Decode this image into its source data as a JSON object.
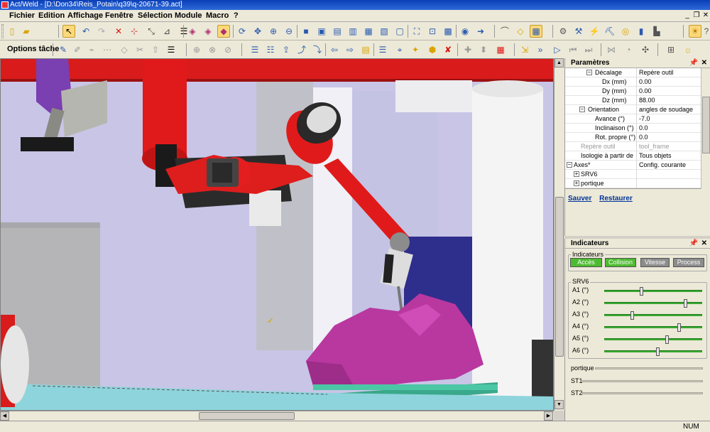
{
  "app": {
    "title": "Act/Weld - [D:\\Don34\\Reis_Potain\\q39\\q-20671-39.act]"
  },
  "menu": {
    "items": [
      "Fichier",
      "Edition",
      "Affichage",
      "Fenêtre",
      "Sélection",
      "Module",
      "Macro",
      "?"
    ]
  },
  "toolbar2": {
    "options_label": "Options tâche"
  },
  "parametres": {
    "title": "Paramètres",
    "rows": [
      {
        "key": "Décalage",
        "value": "Repère outil",
        "expander": "minus"
      },
      {
        "key": "Dx (mm)",
        "value": "0.00"
      },
      {
        "key": "Dy (mm)",
        "value": "0.00"
      },
      {
        "key": "Dz (mm)",
        "value": "88.00"
      },
      {
        "key": "Orientation",
        "value": "angles de soudage",
        "expander": "minus"
      },
      {
        "key": "Avance (°)",
        "value": "-7.0"
      },
      {
        "key": "Inclinaison (°)",
        "value": "0.0"
      },
      {
        "key": "Rot. propre (°)",
        "value": "0.0"
      },
      {
        "key": "Repère outil",
        "value": "tool_frame"
      },
      {
        "key": "Isologie à partir de",
        "value": "Tous objets"
      },
      {
        "key": "Axes*",
        "value": "Config. courante",
        "expander": "minus"
      },
      {
        "key": "SRV6",
        "value": "",
        "expander": "plus"
      },
      {
        "key": "portique",
        "value": "",
        "expander": "plus"
      }
    ],
    "save_label": "Sauver",
    "restore_label": "Restaurer"
  },
  "indicateurs": {
    "title": "Indicateurs",
    "group_label": "Indicateurs",
    "buttons": [
      {
        "label": "Accès",
        "state": "on"
      },
      {
        "label": "Collision",
        "state": "on"
      },
      {
        "label": "Vitesse",
        "state": "off"
      },
      {
        "label": "Process",
        "state": "off"
      }
    ],
    "srv6_label": "SRV6",
    "axes": [
      {
        "label": "A1 (°)",
        "level": 0.38
      },
      {
        "label": "A2 (°)",
        "level": 0.85
      },
      {
        "label": "A3 (°)",
        "level": 0.28
      },
      {
        "label": "A4 (°)",
        "level": 0.78
      },
      {
        "label": "A5 (°)",
        "level": 0.65
      },
      {
        "label": "A6 (°)",
        "level": 0.55
      }
    ],
    "groups": [
      "portique",
      "ST1",
      "ST2"
    ]
  },
  "status": {
    "num": "NUM"
  },
  "icons": {
    "tb1": [
      "new-file-icon",
      "open-folder-icon",
      "select-arrow-icon",
      "undo-icon",
      "redo-icon",
      "cut-point-icon",
      "frame-icon",
      "link-icon",
      "geometry-icon",
      "list-icon",
      "paint-icon",
      "paint-alt-icon",
      "paint-active-icon",
      "rotate-icon",
      "pan-icon",
      "zoom-in-icon",
      "zoom-out-icon",
      "cube-front-icon",
      "cube-top-icon",
      "cube-side-icon",
      "cube-iso-icon",
      "cube-back-icon",
      "cube-bottom-icon",
      "cube-wire-icon",
      "fit-all-icon",
      "fit-selection-icon",
      "render-icon",
      "camera-icon",
      "record-icon",
      "arc-icon",
      "eraser-icon",
      "grid-icon",
      "robot-icon",
      "tool-icon",
      "weld-icon",
      "gripper-icon",
      "cable-icon",
      "magnet-icon",
      "fixture-icon",
      "lamp-icon",
      "help-icon"
    ],
    "tb2": [
      "tag-icon",
      "wand-icon",
      "snap-icon",
      "path-icon",
      "point-edit-icon",
      "split-icon",
      "align-icon",
      "table-icon",
      "list-add-icon",
      "list-remove-icon",
      "move-up-icon",
      "move-down-icon",
      "arrow-left-icon",
      "arrow-right-icon",
      "clipboard-icon",
      "checklist-icon",
      "frame-xyz-icon",
      "sort-icon",
      "shuffle-icon",
      "weld-torch-icon",
      "cross-icon",
      "cut-icon",
      "sequence-icon",
      "play-icon",
      "step-icon",
      "stop-icon",
      "sim-back-icon",
      "sim-forward-icon",
      "teach-icon",
      "probe-icon",
      "collision-icon",
      "export-icon",
      "reach-icon",
      "lamp-icon",
      "gauge-icon"
    ]
  }
}
